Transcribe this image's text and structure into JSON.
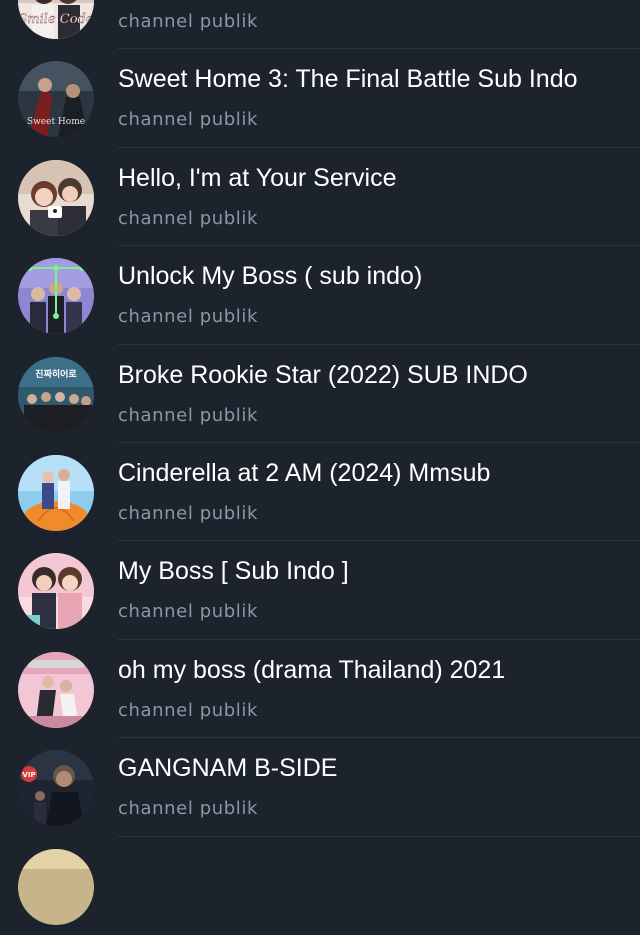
{
  "colors": {
    "background": "#1c232d",
    "title": "#ffffff",
    "subtitle": "#8d96a2",
    "divider": "#2d3540"
  },
  "channels": [
    {
      "title": "",
      "subtitle": "channel publik",
      "avatar_text": "Smile Code",
      "avatar_icon": "smile-code-poster-icon"
    },
    {
      "title": "Sweet Home 3: The Final Battle Sub Indo",
      "subtitle": "channel publik",
      "avatar_text": "Sweet Home",
      "avatar_icon": "sweet-home-poster-icon"
    },
    {
      "title": "Hello, I'm at Your Service",
      "subtitle": "channel publik",
      "avatar_text": "",
      "avatar_icon": "couple-poster-icon"
    },
    {
      "title": "Unlock My Boss ( sub indo)",
      "subtitle": "channel publik",
      "avatar_text": "",
      "avatar_icon": "unlock-pattern-poster-icon"
    },
    {
      "title": "Broke Rookie Star (2022) SUB INDO",
      "subtitle": "channel publik",
      "avatar_text": "진짜히어로",
      "avatar_icon": "group-poster-icon"
    },
    {
      "title": "Cinderella at 2 AM (2024) Mmsub",
      "subtitle": "channel publik",
      "avatar_text": "",
      "avatar_icon": "pumpkin-poster-icon"
    },
    {
      "title": "My Boss [ Sub Indo ]",
      "subtitle": "channel publik",
      "avatar_text": "",
      "avatar_icon": "pink-couple-poster-icon"
    },
    {
      "title": "oh my boss (drama Thailand) 2021",
      "subtitle": "channel publik",
      "avatar_text": "",
      "avatar_icon": "office-poster-icon"
    },
    {
      "title": "GANGNAM B-SIDE",
      "subtitle": "channel publik",
      "avatar_text": "VIP",
      "avatar_icon": "dark-poster-icon"
    },
    {
      "title": "",
      "subtitle": "",
      "avatar_text": "",
      "avatar_icon": "partial-poster-icon"
    }
  ]
}
